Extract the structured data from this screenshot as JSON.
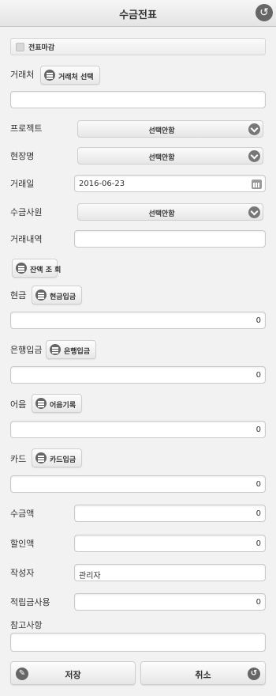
{
  "header": {
    "title": "수금전표",
    "back_icon": "back-arrow-icon"
  },
  "close_check": {
    "label": "전표마감",
    "checked": false
  },
  "client": {
    "label": "거래처",
    "button": "거래처 선택",
    "value": ""
  },
  "project": {
    "label": "프로젝트",
    "selected": "선택안함"
  },
  "site": {
    "label": "현장명",
    "selected": "선택안함"
  },
  "trade_date": {
    "label": "거래일",
    "value": "2016-06-23"
  },
  "collector": {
    "label": "수금사원",
    "selected": "선택안함"
  },
  "detail": {
    "label": "거래내역",
    "value": ""
  },
  "balance_button": "잔액 조 회",
  "cash": {
    "label": "현금",
    "button": "현금입금",
    "value": "0"
  },
  "bank": {
    "label": "은행입금",
    "button": "은행입금",
    "value": "0"
  },
  "bill": {
    "label": "어음",
    "button": "어음기록",
    "value": "0"
  },
  "card": {
    "label": "카드",
    "button": "카드입금",
    "value": "0"
  },
  "amount": {
    "label": "수금액",
    "value": "0"
  },
  "discount": {
    "label": "할인액",
    "value": "0"
  },
  "writer": {
    "label": "작성자",
    "value": "관리자"
  },
  "points": {
    "label": "적립금사용",
    "value": "0"
  },
  "notes": {
    "label": "참고사항",
    "value": ""
  },
  "actions": {
    "save": "저장",
    "cancel": "취소"
  }
}
